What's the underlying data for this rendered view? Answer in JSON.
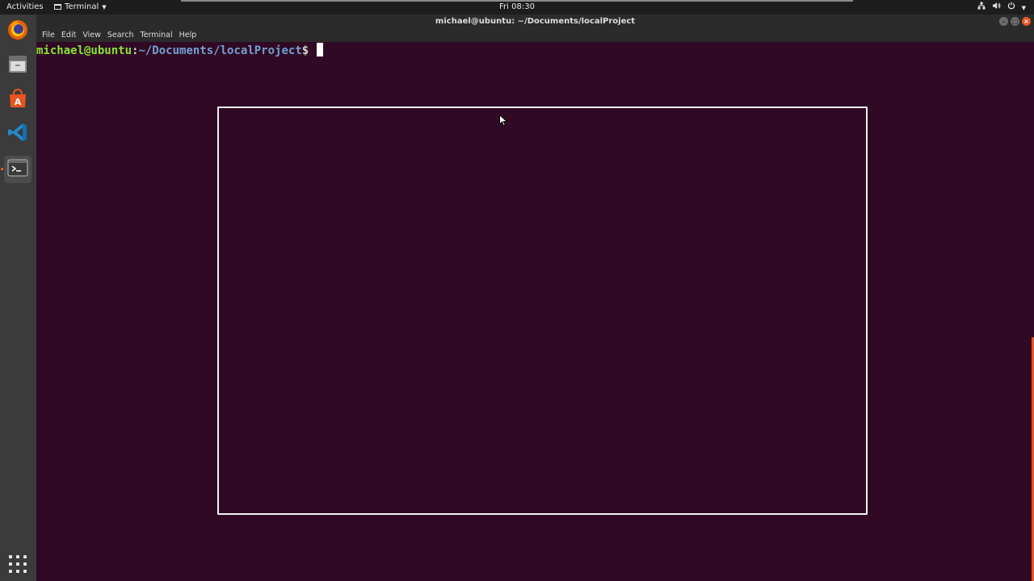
{
  "topbar": {
    "activities": "Activities",
    "app_name": "Terminal",
    "clock": "Fri 08:30",
    "sys_icons": [
      "network-icon",
      "volume-icon",
      "power-icon"
    ]
  },
  "dock": {
    "items": [
      {
        "name": "firefox-icon",
        "active": false
      },
      {
        "name": "files-icon",
        "active": false
      },
      {
        "name": "software-center-icon",
        "active": false
      },
      {
        "name": "vscode-icon",
        "active": false
      },
      {
        "name": "terminal-icon",
        "active": true
      }
    ],
    "show_apps": "apps-grid-icon"
  },
  "window": {
    "title": "michael@ubuntu: ~/Documents/localProject",
    "menu": [
      "File",
      "Edit",
      "View",
      "Search",
      "Terminal",
      "Help"
    ]
  },
  "terminal": {
    "user": "michael@ubuntu",
    "colon": ":",
    "path": "~/Documents/localProject",
    "dollar": "$ "
  },
  "colors": {
    "background": "#300a24",
    "user_green": "#8ae234",
    "path_blue": "#729fcf",
    "accent": "#e95420"
  }
}
